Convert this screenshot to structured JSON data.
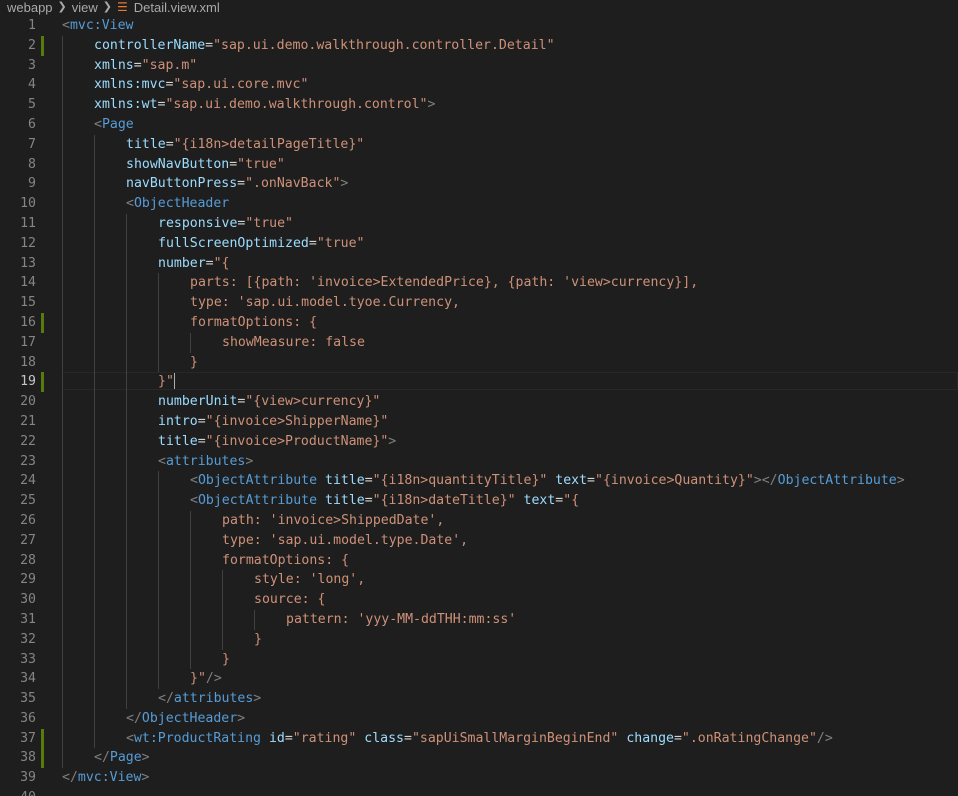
{
  "breadcrumb": {
    "items": [
      "webapp",
      "view",
      "Detail.view.xml"
    ]
  },
  "editor": {
    "language": "xml",
    "current_line": 19,
    "lines": [
      {
        "n": 1,
        "indent": 0,
        "modified": false,
        "tokens": [
          [
            "br",
            "<"
          ],
          [
            "tag",
            "mvc:View"
          ]
        ]
      },
      {
        "n": 2,
        "indent": 1,
        "modified": true,
        "tokens": [
          [
            "attr",
            "controllerName"
          ],
          [
            "eq",
            "="
          ],
          [
            "str",
            "\"sap.ui.demo.walkthrough.controller.Detail\""
          ]
        ]
      },
      {
        "n": 3,
        "indent": 1,
        "modified": false,
        "tokens": [
          [
            "attr",
            "xmlns"
          ],
          [
            "eq",
            "="
          ],
          [
            "str",
            "\"sap.m\""
          ]
        ]
      },
      {
        "n": 4,
        "indent": 1,
        "modified": false,
        "tokens": [
          [
            "attr",
            "xmlns:mvc"
          ],
          [
            "eq",
            "="
          ],
          [
            "str",
            "\"sap.ui.core.mvc\""
          ]
        ]
      },
      {
        "n": 5,
        "indent": 1,
        "modified": false,
        "tokens": [
          [
            "attr",
            "xmlns:wt"
          ],
          [
            "eq",
            "="
          ],
          [
            "str",
            "\"sap.ui.demo.walkthrough.control\""
          ],
          [
            "br",
            ">"
          ]
        ]
      },
      {
        "n": 6,
        "indent": 1,
        "modified": false,
        "tokens": [
          [
            "br",
            "<"
          ],
          [
            "tag",
            "Page"
          ]
        ]
      },
      {
        "n": 7,
        "indent": 2,
        "modified": false,
        "tokens": [
          [
            "attr",
            "title"
          ],
          [
            "eq",
            "="
          ],
          [
            "str",
            "\"{i18n>detailPageTitle}\""
          ]
        ]
      },
      {
        "n": 8,
        "indent": 2,
        "modified": false,
        "tokens": [
          [
            "attr",
            "showNavButton"
          ],
          [
            "eq",
            "="
          ],
          [
            "str",
            "\"true\""
          ]
        ]
      },
      {
        "n": 9,
        "indent": 2,
        "modified": false,
        "tokens": [
          [
            "attr",
            "navButtonPress"
          ],
          [
            "eq",
            "="
          ],
          [
            "str",
            "\".onNavBack\""
          ],
          [
            "br",
            ">"
          ]
        ]
      },
      {
        "n": 10,
        "indent": 2,
        "modified": false,
        "tokens": [
          [
            "br",
            "<"
          ],
          [
            "tag",
            "ObjectHeader"
          ]
        ]
      },
      {
        "n": 11,
        "indent": 3,
        "modified": false,
        "tokens": [
          [
            "attr",
            "responsive"
          ],
          [
            "eq",
            "="
          ],
          [
            "str",
            "\"true\""
          ]
        ]
      },
      {
        "n": 12,
        "indent": 3,
        "modified": false,
        "tokens": [
          [
            "attr",
            "fullScreenOptimized"
          ],
          [
            "eq",
            "="
          ],
          [
            "str",
            "\"true\""
          ]
        ]
      },
      {
        "n": 13,
        "indent": 3,
        "modified": false,
        "tokens": [
          [
            "attr",
            "number"
          ],
          [
            "eq",
            "="
          ],
          [
            "str",
            "\"{"
          ]
        ]
      },
      {
        "n": 14,
        "indent": 4,
        "modified": false,
        "tokens": [
          [
            "str",
            "parts: [{path: 'invoice>ExtendedPrice}, {path: 'view>currency}],"
          ]
        ]
      },
      {
        "n": 15,
        "indent": 4,
        "modified": false,
        "tokens": [
          [
            "str",
            "type: 'sap.ui.model.tyoe.Currency,"
          ]
        ]
      },
      {
        "n": 16,
        "indent": 4,
        "modified": true,
        "tokens": [
          [
            "str",
            "formatOptions: {"
          ]
        ]
      },
      {
        "n": 17,
        "indent": 5,
        "modified": false,
        "tokens": [
          [
            "str",
            "showMeasure: false"
          ]
        ]
      },
      {
        "n": 18,
        "indent": 4,
        "modified": false,
        "tokens": [
          [
            "str",
            "}"
          ]
        ]
      },
      {
        "n": 19,
        "indent": 3,
        "modified": true,
        "cursor": true,
        "tokens": [
          [
            "str",
            "}\""
          ]
        ]
      },
      {
        "n": 20,
        "indent": 3,
        "modified": false,
        "tokens": [
          [
            "attr",
            "numberUnit"
          ],
          [
            "eq",
            "="
          ],
          [
            "str",
            "\"{view>currency}\""
          ]
        ]
      },
      {
        "n": 21,
        "indent": 3,
        "modified": false,
        "tokens": [
          [
            "attr",
            "intro"
          ],
          [
            "eq",
            "="
          ],
          [
            "str",
            "\"{invoice>ShipperName}\""
          ]
        ]
      },
      {
        "n": 22,
        "indent": 3,
        "modified": false,
        "tokens": [
          [
            "attr",
            "title"
          ],
          [
            "eq",
            "="
          ],
          [
            "str",
            "\"{invoice>ProductName}\""
          ],
          [
            "br",
            ">"
          ]
        ]
      },
      {
        "n": 23,
        "indent": 3,
        "modified": false,
        "tokens": [
          [
            "br",
            "<"
          ],
          [
            "tag",
            "attributes"
          ],
          [
            "br",
            ">"
          ]
        ]
      },
      {
        "n": 24,
        "indent": 4,
        "modified": false,
        "tokens": [
          [
            "br",
            "<"
          ],
          [
            "tag",
            "ObjectAttribute"
          ],
          [
            "eq",
            " "
          ],
          [
            "attr",
            "title"
          ],
          [
            "eq",
            "="
          ],
          [
            "str",
            "\"{i18n>quantityTitle}\""
          ],
          [
            "eq",
            " "
          ],
          [
            "attr",
            "text"
          ],
          [
            "eq",
            "="
          ],
          [
            "str",
            "\"{invoice>Quantity}\""
          ],
          [
            "br",
            "></"
          ],
          [
            "tag",
            "ObjectAttribute"
          ],
          [
            "br",
            ">"
          ]
        ]
      },
      {
        "n": 25,
        "indent": 4,
        "modified": false,
        "tokens": [
          [
            "br",
            "<"
          ],
          [
            "tag",
            "ObjectAttribute"
          ],
          [
            "eq",
            " "
          ],
          [
            "attr",
            "title"
          ],
          [
            "eq",
            "="
          ],
          [
            "str",
            "\"{i18n>dateTitle}\""
          ],
          [
            "eq",
            " "
          ],
          [
            "attr",
            "text"
          ],
          [
            "eq",
            "="
          ],
          [
            "str",
            "\"{"
          ]
        ]
      },
      {
        "n": 26,
        "indent": 5,
        "modified": false,
        "tokens": [
          [
            "str",
            "path: 'invoice>ShippedDate',"
          ]
        ]
      },
      {
        "n": 27,
        "indent": 5,
        "modified": false,
        "tokens": [
          [
            "str",
            "type: 'sap.ui.model.type.Date',"
          ]
        ]
      },
      {
        "n": 28,
        "indent": 5,
        "modified": false,
        "tokens": [
          [
            "str",
            "formatOptions: {"
          ]
        ]
      },
      {
        "n": 29,
        "indent": 6,
        "modified": false,
        "tokens": [
          [
            "str",
            "style: 'long',"
          ]
        ]
      },
      {
        "n": 30,
        "indent": 6,
        "modified": false,
        "tokens": [
          [
            "str",
            "source: {"
          ]
        ]
      },
      {
        "n": 31,
        "indent": 7,
        "modified": false,
        "tokens": [
          [
            "str",
            "pattern: 'yyy-MM-ddTHH:mm:ss'"
          ]
        ]
      },
      {
        "n": 32,
        "indent": 6,
        "modified": false,
        "tokens": [
          [
            "str",
            "}"
          ]
        ]
      },
      {
        "n": 33,
        "indent": 5,
        "modified": false,
        "tokens": [
          [
            "str",
            "}"
          ]
        ]
      },
      {
        "n": 34,
        "indent": 4,
        "modified": false,
        "tokens": [
          [
            "str",
            "}\""
          ],
          [
            "br",
            "/>"
          ]
        ]
      },
      {
        "n": 35,
        "indent": 3,
        "modified": false,
        "tokens": [
          [
            "br",
            "</"
          ],
          [
            "tag",
            "attributes"
          ],
          [
            "br",
            ">"
          ]
        ]
      },
      {
        "n": 36,
        "indent": 2,
        "modified": false,
        "tokens": [
          [
            "br",
            "</"
          ],
          [
            "tag",
            "ObjectHeader"
          ],
          [
            "br",
            ">"
          ]
        ]
      },
      {
        "n": 37,
        "indent": 2,
        "modified": true,
        "tokens": [
          [
            "br",
            "<"
          ],
          [
            "tag",
            "wt:ProductRating"
          ],
          [
            "eq",
            " "
          ],
          [
            "attr",
            "id"
          ],
          [
            "eq",
            "="
          ],
          [
            "str",
            "\"rating\""
          ],
          [
            "eq",
            " "
          ],
          [
            "attr",
            "class"
          ],
          [
            "eq",
            "="
          ],
          [
            "str",
            "\"sapUiSmallMarginBeginEnd\""
          ],
          [
            "eq",
            " "
          ],
          [
            "attr",
            "change"
          ],
          [
            "eq",
            "="
          ],
          [
            "str",
            "\".onRatingChange\""
          ],
          [
            "br",
            "/>"
          ]
        ]
      },
      {
        "n": 38,
        "indent": 1,
        "modified": true,
        "tokens": [
          [
            "br",
            "</"
          ],
          [
            "tag",
            "Page"
          ],
          [
            "br",
            ">"
          ]
        ]
      },
      {
        "n": 39,
        "indent": 0,
        "modified": false,
        "tokens": [
          [
            "br",
            "</"
          ],
          [
            "tag",
            "mvc:View"
          ],
          [
            "br",
            ">"
          ]
        ]
      },
      {
        "n": 40,
        "indent": 0,
        "modified": false,
        "tokens": []
      }
    ]
  },
  "colors": {
    "background": "#1e1e1e",
    "tag": "#569cd6",
    "attribute": "#9cdcfe",
    "string": "#ce9178",
    "punctuation": "#808080",
    "modified_marker": "#587c0c"
  },
  "icons": {
    "file_type": "rss-icon",
    "separator": "chevron-right-icon"
  }
}
